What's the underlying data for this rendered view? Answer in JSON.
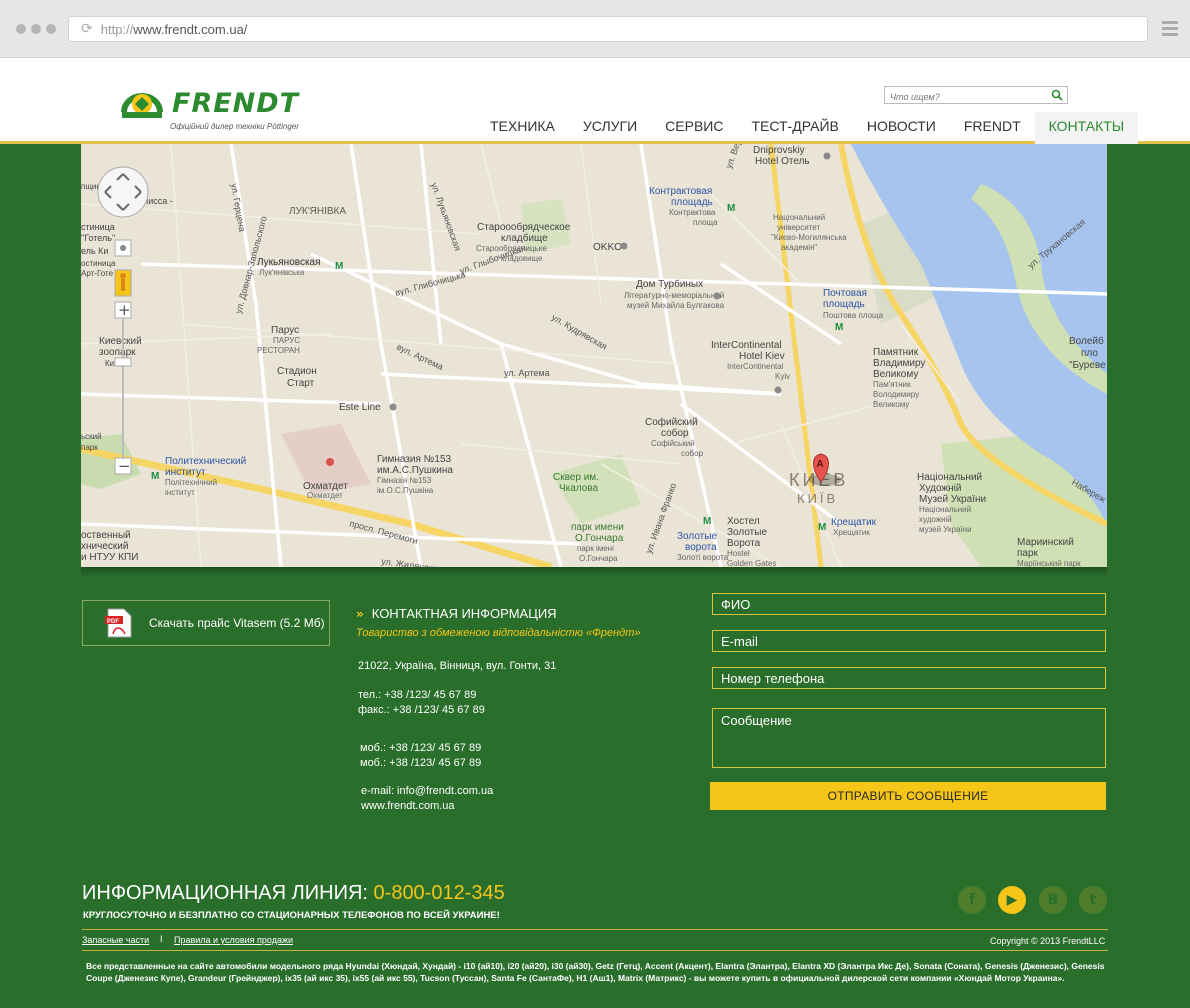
{
  "browser": {
    "url_prefix": "http://",
    "url_host": "www.frendt.com.ua/"
  },
  "header": {
    "logo_text": "FRENDT",
    "logo_sub": "Офіційний дилер техніки Pöttinger",
    "search_placeholder": "Что ищем?",
    "nav": [
      "ТЕХНИКА",
      "УСЛУГИ",
      "СЕРВИС",
      "ТЕСТ-ДРАЙВ",
      "НОВОСТИ",
      "FRENDT",
      "КОНТАКТЫ"
    ]
  },
  "map": {
    "marker": "A",
    "pan_icon": "pan-control-icon",
    "zoom_in": "+",
    "zoom_out": "−",
    "labels": {
      "l1": "ЛУК'ЯНІВКА",
      "l2": "Лукьяновская",
      "l3": "Лук'янівська",
      "l4": "Староообрядческое",
      "l5": "кладбище",
      "l6": "Старообрядницьке",
      "l7": "кладовище",
      "l8": "Контрактовая",
      "l9": "площадь",
      "l10": "Контрактова",
      "l11": "площа",
      "l12": "Dniprovskiy",
      "l13": "Hotel Отель",
      "l14": "Національний",
      "l15": "університет",
      "l16": "\"Києво-Могилянська",
      "l17": "академія\"",
      "l18": "OKKO",
      "l19": "Дом Турбиных",
      "l20": "Літературно-меморіальний",
      "l21": "музей Михайла Булгакова",
      "l22": "Почтовая",
      "l23": "площадь",
      "l24": "Поштова площа",
      "l25": "Парус",
      "l26": "ПАРУС",
      "l27": "РЕСТОРАН",
      "l28": "Киевский",
      "l29": "зоопарк",
      "l30": "Стадион",
      "l31": "Старт",
      "l32": "Este Line",
      "l33": "InterContinental",
      "l34": "Hotel Kiev",
      "l35": "InterContinental",
      "l36": "Kyiv",
      "l37": "Памятник",
      "l38": "Владимиру",
      "l39": "Великому",
      "l40": "Пам'ятник",
      "l41": "Володимиру",
      "l42": "Великому",
      "l43": "Волейб",
      "l44": "пло",
      "l45": "\"Буреве",
      "l46": "Политехнический",
      "l47": "институт",
      "l48": "Політехнічний",
      "l49": "інститут",
      "l50": "Охматдет",
      "l51": "Охматдет",
      "l52": "Гимназия №153",
      "l53": "им.А.С.Пушкина",
      "l54": "Гімназія №153",
      "l55": "ім.О.С.Пушкіна",
      "l56": "Софийский",
      "l57": "собор",
      "l58": "Софійський",
      "l59": "собор",
      "l60": "КИЕВ",
      "l61": "КИЇВ",
      "l62": "Національний",
      "l63": "Художній",
      "l64": "Музей України",
      "l65": "Національний",
      "l66": "художній",
      "l67": "музей України",
      "l68": "Сквер им.",
      "l69": "Чкалова",
      "l70": "парк имени",
      "l71": "О.Гончара",
      "l72": "парк імені",
      "l73": "О.Гончара",
      "l74": "Золотые",
      "l75": "ворота",
      "l76": "Золоті ворота",
      "l77": "Хостел",
      "l78": "Золотые",
      "l79": "Ворота",
      "l80": "Hostel",
      "l81": "Golden Gates",
      "l82": "Крещатик",
      "l83": "Хрещатик",
      "l84": "Мариинский",
      "l85": "парк",
      "l86": "Маріїнський парк",
      "l87": "оственный",
      "l88": "хнический",
      "l89": "и НТУУ КПИ",
      "l90": "пщина",
      "l91": "лисса -",
      "l92": "стиница",
      "l93": "\"Готель\"",
      "l94": "ель Ки",
      "l95": "остиница",
      "l96": "Арт-Готе",
      "l97": "Ки",
      "l98": "ьский",
      "l99": "парк"
    },
    "roads": {
      "r1": "ул. Герцена",
      "r2": "ул. Довнар-Запольского",
      "r3": "ул. Лукьяновская",
      "r4": "ул. Глыбочицкая",
      "r5": "вул. Глибочицька",
      "r6": "ул. Кудрявская",
      "r7": "вул. Артема",
      "r8": "ул. Артема",
      "r9": "просп. Перемоги",
      "r10": "ул. Жилянская",
      "r11": "ул. Ивана Франко",
      "r12": "ул. Верх",
      "r13": "ул. Трухановская",
      "r14": "Набереж"
    }
  },
  "download": {
    "label": "Скачать прайс Vitasem (5.2 Мб)",
    "icon": "pdf-icon"
  },
  "contact": {
    "title": "КОНТАКТНАЯ ИНФОРМАЦИЯ",
    "company": "Товариство з обмеженою відповідальністю «Френдт»",
    "address": "21022,  Україна, Вінниця, вул. Гонти, 31",
    "tel": "тел.: +38 /123/ 45 67 89",
    "fax": "факс.: +38 /123/ 45 67 89",
    "mob1": "моб.:  +38 /123/ 45 67 89",
    "mob2": "моб.:  +38 /123/ 45 67 89",
    "email": "e-mail: info@frendt.com.ua",
    "site": "www.frendt.com.ua"
  },
  "form": {
    "name_placeholder": "ФИО",
    "email_placeholder": "E-mail",
    "phone_placeholder": "Номер телефона",
    "message_placeholder": "Сообщение",
    "submit_label": "ОТПРАВИТЬ СООБЩЕНИЕ"
  },
  "footer": {
    "info_label": "ИНФОРМАЦИОННАЯ ЛИНИЯ:",
    "phone": "0-800-012-345",
    "info_sub": "КРУГЛОСУТОЧНО И БЕЗПЛАТНО СО СТАЦИОНАРНЫХ ТЕЛЕФОНОВ ПО ВСЕЙ УКРАИНЕ!",
    "link_parts": "Запасные части",
    "separator": "I",
    "link_terms": "Правила и условия продажи",
    "copyright": "Copyright © 2013 FrendtLLC",
    "disclaimer": "Все представленные на сайте автомобили модельного ряда Hyundai (Хюндай, Хундай) - i10 (ай10), i20 (ай20), i30 (ай30), Getz (Гетц), Accent (Акцент), Elantra (Элантра), Elantra XD (Элантра Икс Де), Sonata (Соната), Genesis (Дженезис), Genesis Coupe (Дженезис Купе), Grandeur (Грейнджер), ix35 (ай икс 35), ix55 (ай икс 55), Tucson (Туссан), Santa Fe (СантаФе), H1 (Аш1), Matrix (Матрикс) - вы можете купить в официальной дилерской сети компании «Хюндай Мотор Украина».",
    "social": [
      {
        "name": "facebook-icon",
        "glyph": "f"
      },
      {
        "name": "youtube-icon",
        "glyph": "▶"
      },
      {
        "name": "vkontakte-icon",
        "glyph": "В"
      },
      {
        "name": "twitter-icon",
        "glyph": "t"
      }
    ]
  },
  "colors": {
    "brand_green": "#2c8a2f",
    "background_green": "#2a6e2c",
    "accent_yellow": "#f5c518"
  }
}
